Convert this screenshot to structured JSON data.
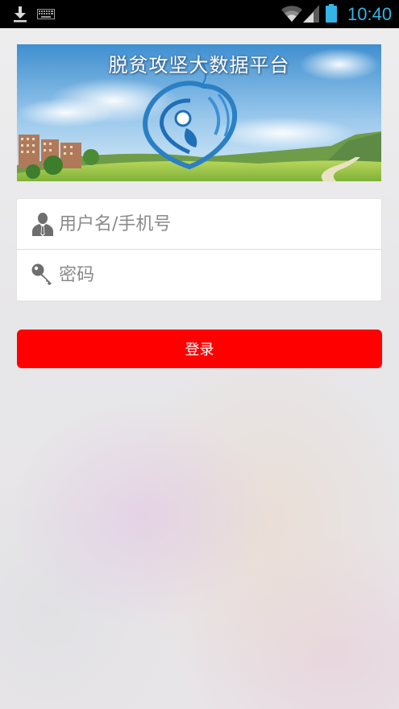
{
  "status_bar": {
    "time": "10:40",
    "icons": [
      "download-icon",
      "keyboard-icon",
      "wifi-icon",
      "signal-icon",
      "battery-icon"
    ],
    "accent_color": "#33b5e5"
  },
  "banner": {
    "title": "脱贫攻坚大数据平台",
    "logo": "heart-leaf-logo"
  },
  "login": {
    "username_placeholder": "用户名/手机号",
    "username_value": "",
    "password_placeholder": "密码",
    "password_value": "",
    "username_icon": "user-icon",
    "password_icon": "key-icon"
  },
  "login_button": {
    "label": "登录",
    "color": "#ff0000"
  }
}
